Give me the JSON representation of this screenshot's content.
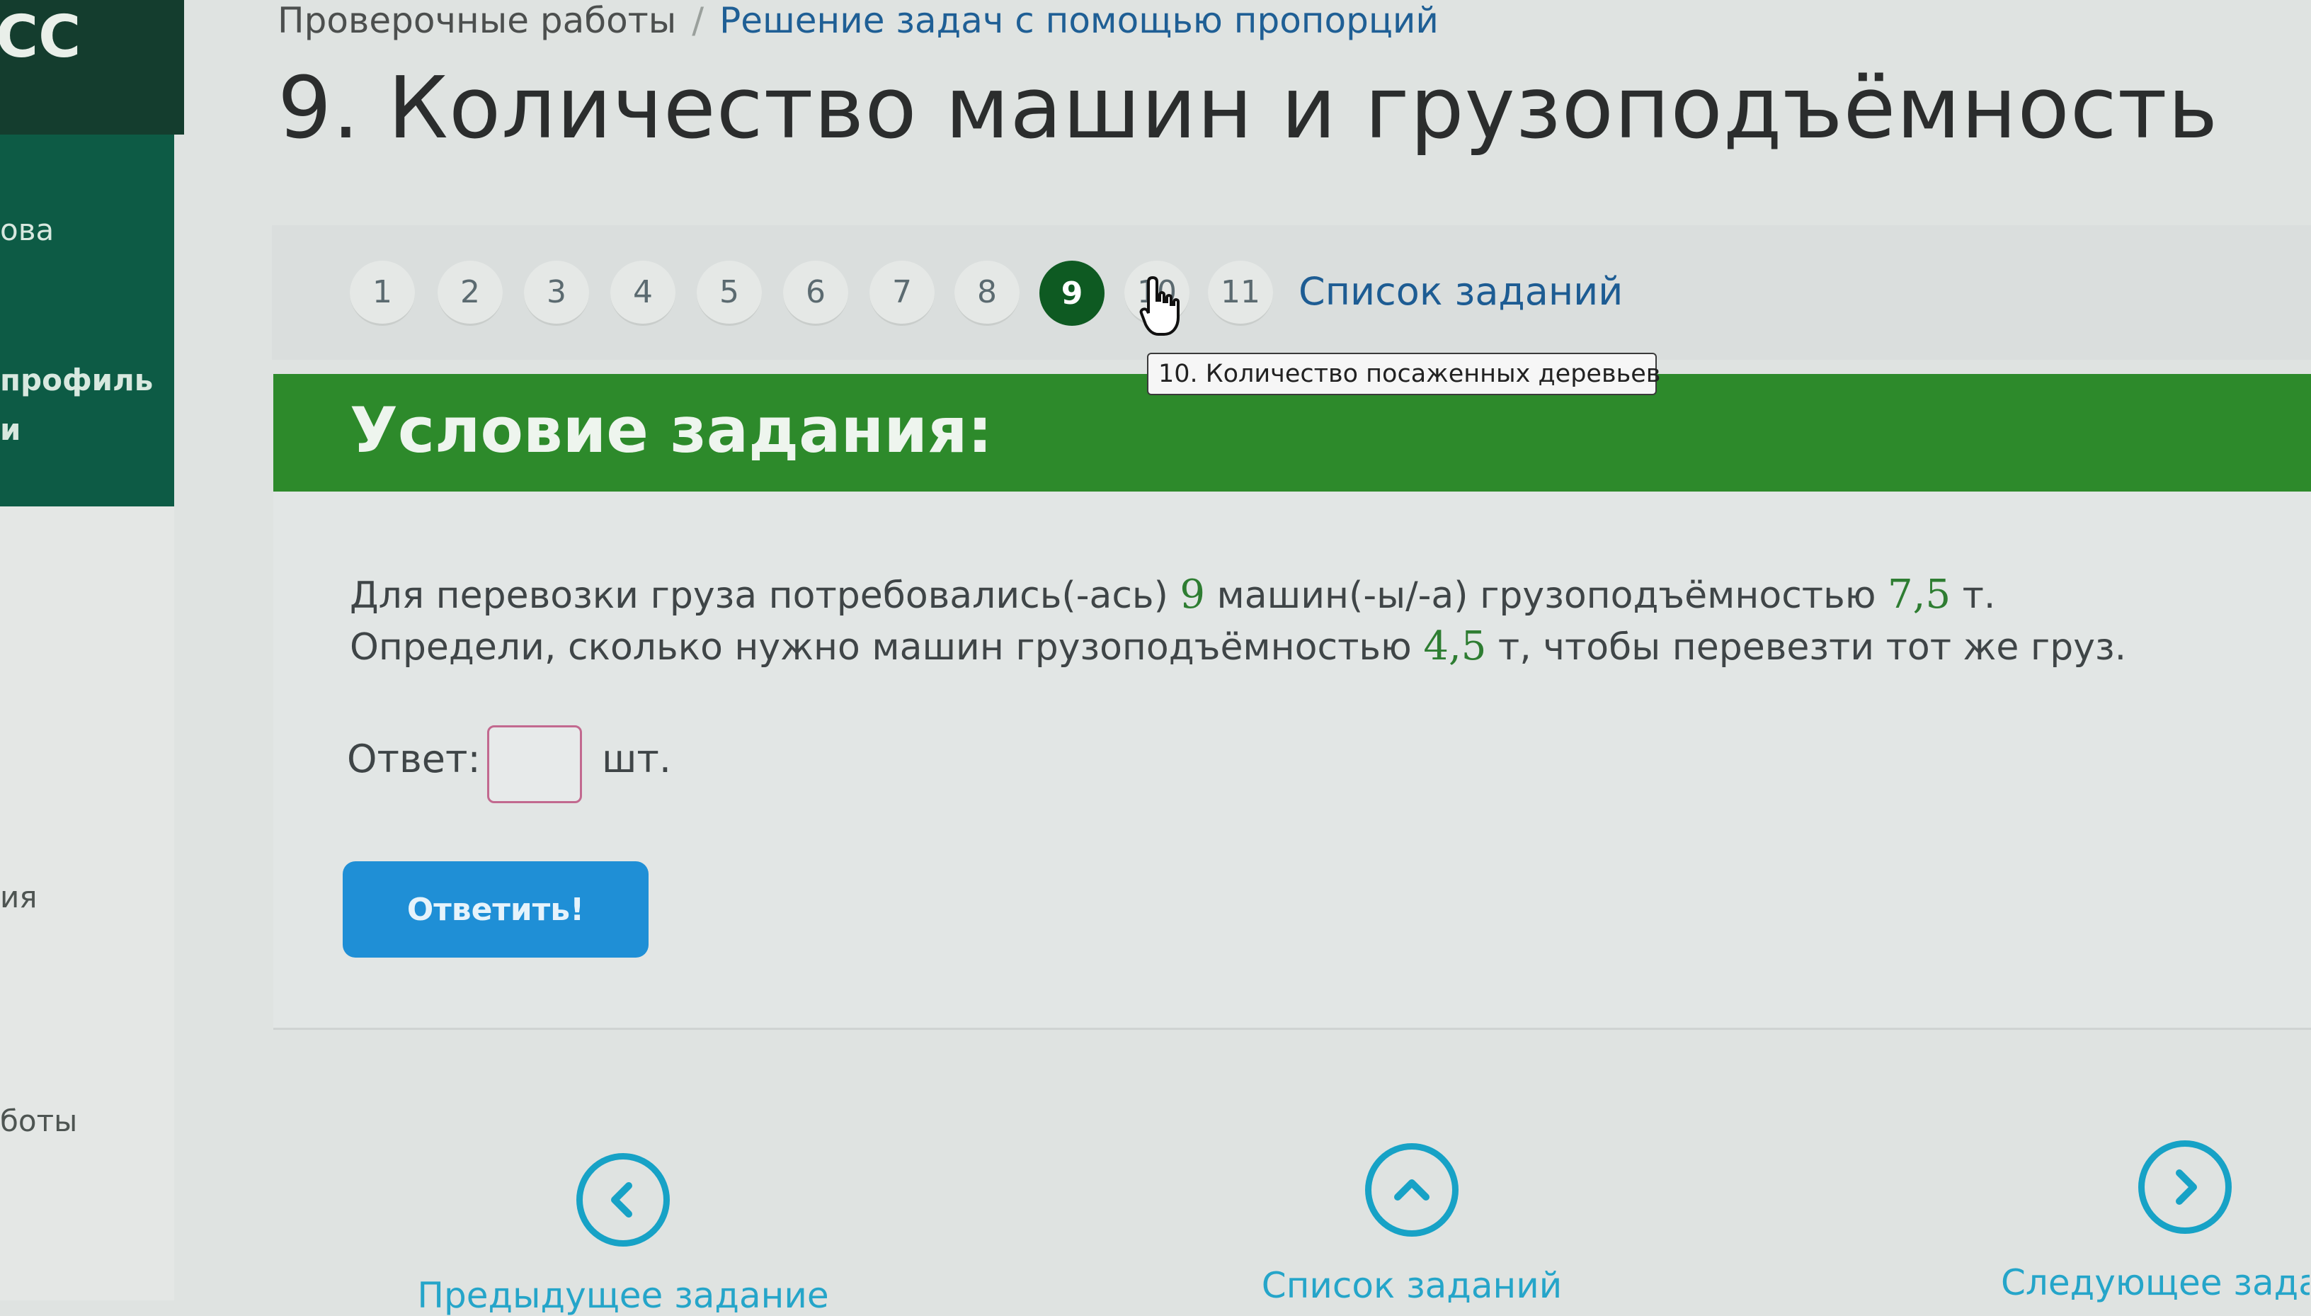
{
  "sidebar": {
    "logo": "СС",
    "items": [
      {
        "label": "ова"
      },
      {
        "label": "профиль"
      },
      {
        "label": "и"
      },
      {
        "label": "ия"
      },
      {
        "label": "боты"
      }
    ]
  },
  "breadcrumb": {
    "parent": "Проверочные работы",
    "separator": "/",
    "current": "Решение задач с помощью пропорций"
  },
  "page_title": "9. Количество машин и грузоподъёмность",
  "task_nav": {
    "numbers": [
      "1",
      "2",
      "3",
      "4",
      "5",
      "6",
      "7",
      "8",
      "9",
      "10",
      "11"
    ],
    "active": "9",
    "list_link": "Список заданий",
    "tooltip": "10. Количество посаженных деревьев"
  },
  "condition": {
    "title": "Условие задания:",
    "line1_a": "Для перевозки груза потребовались(-ась) ",
    "line1_num1": "9",
    "line1_b": " машин(-ы/-а) грузоподъёмностью ",
    "line1_num2": "7,5",
    "line1_c": " т.",
    "line2_a": "Определи, сколько нужно машин грузоподъёмностью ",
    "line2_num": "4,5",
    "line2_b": " т, чтобы перевезти тот же груз."
  },
  "answer": {
    "label": "Ответ:",
    "value": "",
    "unit": "шт.",
    "submit_label": "Ответить!"
  },
  "bottom_nav": {
    "prev_label": "Предыдущее задание",
    "list_label": "Список заданий",
    "next_label": "Следующее задание"
  },
  "colors": {
    "sidebar_dark": "#143d2e",
    "sidebar_menu": "#0d5b45",
    "active_task": "#0e5a22",
    "condition_header": "#2d8a2b",
    "submit_button": "#1f8fd6",
    "bottom_nav": "#17a2c6",
    "number_highlight": "#2e7d32"
  }
}
